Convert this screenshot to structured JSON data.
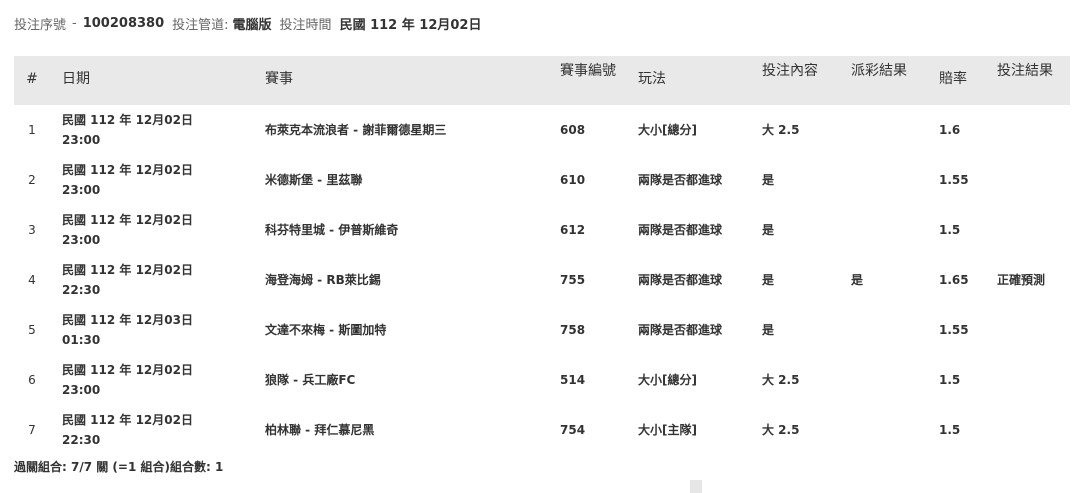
{
  "header": {
    "serial_label": "投注序號",
    "separator": "-",
    "serial_value": "100208380",
    "channel_label": "投注管道:",
    "channel_value": "電腦版",
    "time_label": "投注時間",
    "time_value": "民國 112 年 12月02日"
  },
  "table": {
    "columns": [
      "#",
      "日期",
      "賽事",
      "賽事編號",
      "玩法",
      "投注內容",
      "派彩結果",
      "賠率",
      "投注結果"
    ],
    "rows": [
      {
        "idx": "1",
        "date_line1": "民國 112 年 12月02日",
        "date_line2": "23:00",
        "match": "布萊克本流浪者 - 謝菲爾德星期三",
        "event_no": "608",
        "play": "大小[總分]",
        "bet": "大 2.5",
        "payout": "",
        "odds": "1.6",
        "result": ""
      },
      {
        "idx": "2",
        "date_line1": "民國 112 年 12月02日",
        "date_line2": "23:00",
        "match": "米德斯堡 - 里茲聯",
        "event_no": "610",
        "play": "兩隊是否都進球",
        "bet": "是",
        "payout": "",
        "odds": "1.55",
        "result": ""
      },
      {
        "idx": "3",
        "date_line1": "民國 112 年 12月02日",
        "date_line2": "23:00",
        "match": "科芬特里城 - 伊普斯維奇",
        "event_no": "612",
        "play": "兩隊是否都進球",
        "bet": "是",
        "payout": "",
        "odds": "1.5",
        "result": ""
      },
      {
        "idx": "4",
        "date_line1": "民國 112 年 12月02日",
        "date_line2": "22:30",
        "match": "海登海姆 - RB萊比錫",
        "event_no": "755",
        "play": "兩隊是否都進球",
        "bet": "是",
        "payout": "是",
        "odds": "1.65",
        "result": "正確預測"
      },
      {
        "idx": "5",
        "date_line1": "民國 112 年 12月03日",
        "date_line2": "01:30",
        "match": "文達不來梅 - 斯圖加特",
        "event_no": "758",
        "play": "兩隊是否都進球",
        "bet": "是",
        "payout": "",
        "odds": "1.55",
        "result": ""
      },
      {
        "idx": "6",
        "date_line1": "民國 112 年 12月02日",
        "date_line2": "23:00",
        "match": "狼隊 - 兵工廠FC",
        "event_no": "514",
        "play": "大小[總分]",
        "bet": "大 2.5",
        "payout": "",
        "odds": "1.5",
        "result": ""
      },
      {
        "idx": "7",
        "date_line1": "民國 112 年 12月02日",
        "date_line2": "22:30",
        "match": "柏林聯 - 拜仁慕尼黑",
        "event_no": "754",
        "play": "大小[主隊]",
        "bet": "大 2.5",
        "payout": "",
        "odds": "1.5",
        "result": ""
      }
    ]
  },
  "footer": {
    "summary": "過關組合: 7/7 關 (=1 組合)組合數: 1"
  }
}
